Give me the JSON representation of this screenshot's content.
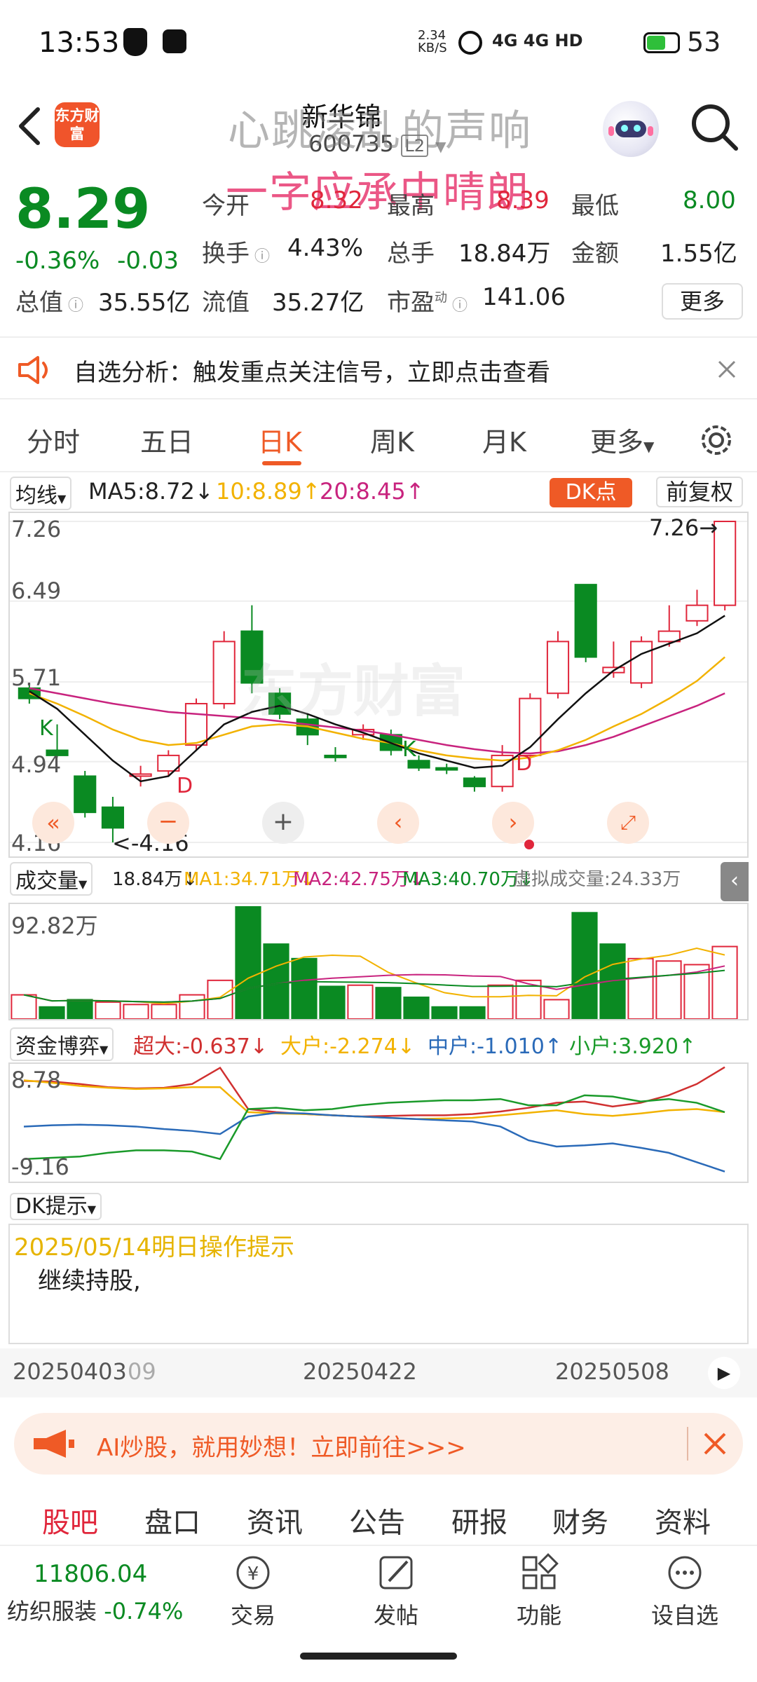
{
  "status_bar": {
    "time": "13:53",
    "net_speed": "2.34 KB/S",
    "indicators": "4G 4G HD",
    "battery": "53"
  },
  "header": {
    "logo": "东方财富",
    "stock_name": "新华锦",
    "stock_code": "600735",
    "level_badge": "L2",
    "overlay_line1": "心跳凌乱的声响",
    "overlay_line2": "一字应承中晴朗"
  },
  "quote": {
    "price": "8.29",
    "change_pct": "-0.36%",
    "change": "-0.03",
    "rows": [
      [
        {
          "label": "今开",
          "value": "8.32",
          "color": "red"
        },
        {
          "label": "最高",
          "value": "8.39",
          "color": "red"
        },
        {
          "label": "最低",
          "value": "8.00",
          "color": "green"
        }
      ],
      [
        {
          "label": "换手",
          "value": "4.43%",
          "color": "black"
        },
        {
          "label": "总手",
          "value": "18.84万",
          "color": "black"
        },
        {
          "label": "金额",
          "value": "1.55亿",
          "color": "black"
        }
      ]
    ],
    "total_value_label": "总值",
    "total_value": "35.55亿",
    "float_value_label": "流值",
    "float_value": "35.27亿",
    "pe_label": "市盈",
    "pe_sup": "动",
    "pe_value": "141.06",
    "more": "更多"
  },
  "notice": {
    "text": "自选分析：触发重点关注信号，立即点击查看"
  },
  "tabs": [
    "分时",
    "五日",
    "日K",
    "周K",
    "月K",
    "更多"
  ],
  "active_tab": "日K",
  "ma_row": {
    "selector": "均线",
    "ma5": "MA5:8.72↓",
    "ma10": "10:8.89↑",
    "ma20": "20:8.45↑",
    "dk_button": "DK点",
    "fuquan": "前复权"
  },
  "kline": {
    "y_labels": [
      "7.26",
      "6.49",
      "5.71",
      "4.94",
      "4.16"
    ],
    "max_marker": "7.26→",
    "min_marker": "<-4.16",
    "k_marks": [
      "K",
      "K"
    ],
    "d_marks": [
      "D",
      "D"
    ],
    "watermark": "东方财富"
  },
  "volume": {
    "selector": "成交量",
    "current": "18.84万↓",
    "ma1": "MA1:34.71万↓",
    "ma2": "MA2:42.75万↓",
    "ma3": "MA3:40.70万↓",
    "virtual": "虚拟成交量:24.33万",
    "max_label": "92.82万"
  },
  "fund": {
    "selector": "资金博弈",
    "super": "超大:-0.637↓",
    "large": "大户:-2.274↓",
    "mid": "中户:-1.010↑",
    "small": "小户:3.920↑",
    "max_label": "8.78",
    "min_label": "-9.16"
  },
  "dk_tip": {
    "selector": "DK提示",
    "title": "2025/05/14明日操作提示",
    "content": "继续持股,"
  },
  "dates": [
    "20250403",
    "09",
    "20250422",
    "20250508"
  ],
  "ai_banner": {
    "text": "AI炒股，就用妙想！立即前往>>>"
  },
  "sub_tabs": [
    "股吧",
    "盘口",
    "资讯",
    "公告",
    "研报",
    "财务",
    "资料"
  ],
  "bottom_nav": {
    "index_value": "11806.04",
    "index_name": "纺织服装",
    "index_change": "-0.74%",
    "items": [
      "交易",
      "发帖",
      "功能",
      "设自选"
    ]
  },
  "colors": {
    "up": "#e0263b",
    "down": "#0a8a22",
    "accent": "#ef5a26",
    "ma5": "#111111",
    "ma10": "#f2b200",
    "ma20": "#c8237e"
  },
  "chart_data": [
    {
      "type": "candlestick",
      "ylim": [
        4.16,
        7.26
      ],
      "candles": [
        {
          "o": 5.65,
          "c": 5.55,
          "h": 5.7,
          "l": 5.5
        },
        {
          "o": 5.05,
          "c": 5.0,
          "h": 5.3,
          "l": 4.98
        },
        {
          "o": 4.8,
          "c": 4.45,
          "h": 4.85,
          "l": 4.4
        },
        {
          "o": 4.5,
          "c": 4.3,
          "h": 4.6,
          "l": 4.16
        },
        {
          "o": 4.8,
          "c": 4.82,
          "h": 4.9,
          "l": 4.7
        },
        {
          "o": 4.85,
          "c": 5.0,
          "h": 5.05,
          "l": 4.8
        },
        {
          "o": 5.1,
          "c": 5.5,
          "h": 5.55,
          "l": 5.05
        },
        {
          "o": 5.5,
          "c": 6.1,
          "h": 6.2,
          "l": 5.45
        },
        {
          "o": 6.2,
          "c": 5.7,
          "h": 6.45,
          "l": 5.6
        },
        {
          "o": 5.6,
          "c": 5.4,
          "h": 5.65,
          "l": 5.35
        },
        {
          "o": 5.35,
          "c": 5.2,
          "h": 5.4,
          "l": 5.1
        },
        {
          "o": 5.0,
          "c": 4.98,
          "h": 5.08,
          "l": 4.94
        },
        {
          "o": 5.2,
          "c": 5.25,
          "h": 5.3,
          "l": 5.15
        },
        {
          "o": 5.2,
          "c": 5.05,
          "h": 5.25,
          "l": 5.0
        },
        {
          "o": 4.95,
          "c": 4.88,
          "h": 5.0,
          "l": 4.85
        },
        {
          "o": 4.88,
          "c": 4.86,
          "h": 4.92,
          "l": 4.82
        },
        {
          "o": 4.78,
          "c": 4.7,
          "h": 4.8,
          "l": 4.65
        },
        {
          "o": 4.7,
          "c": 5.0,
          "h": 5.1,
          "l": 4.65
        },
        {
          "o": 5.0,
          "c": 5.55,
          "h": 5.6,
          "l": 4.95
        },
        {
          "o": 5.6,
          "c": 6.1,
          "h": 6.2,
          "l": 5.55
        },
        {
          "o": 6.65,
          "c": 5.95,
          "h": 6.65,
          "l": 5.9
        },
        {
          "o": 5.8,
          "c": 5.85,
          "h": 6.1,
          "l": 5.75
        },
        {
          "o": 5.7,
          "c": 6.1,
          "h": 6.15,
          "l": 5.65
        },
        {
          "o": 6.1,
          "c": 6.2,
          "h": 6.45,
          "l": 6.05
        },
        {
          "o": 6.3,
          "c": 6.45,
          "h": 6.6,
          "l": 6.25
        },
        {
          "o": 6.45,
          "c": 7.26,
          "h": 7.26,
          "l": 6.4
        }
      ],
      "ma5": [
        5.62,
        5.45,
        5.2,
        4.95,
        4.75,
        4.8,
        5.05,
        5.3,
        5.42,
        5.48,
        5.4,
        5.3,
        5.22,
        5.12,
        5.02,
        4.95,
        4.88,
        4.9,
        5.08,
        5.35,
        5.6,
        5.82,
        5.98,
        6.08,
        6.18,
        6.35
      ],
      "ma10": [
        5.6,
        5.5,
        5.38,
        5.25,
        5.15,
        5.1,
        5.12,
        5.2,
        5.28,
        5.3,
        5.28,
        5.22,
        5.16,
        5.12,
        5.05,
        5.0,
        4.97,
        4.95,
        4.98,
        5.05,
        5.15,
        5.28,
        5.4,
        5.55,
        5.72,
        5.95
      ],
      "ma20": [
        5.65,
        5.6,
        5.55,
        5.5,
        5.46,
        5.42,
        5.4,
        5.38,
        5.36,
        5.33,
        5.3,
        5.27,
        5.24,
        5.2,
        5.15,
        5.1,
        5.06,
        5.03,
        5.02,
        5.04,
        5.1,
        5.18,
        5.28,
        5.38,
        5.48,
        5.6
      ]
    },
    {
      "type": "bar",
      "ylim": [
        0,
        92.82
      ],
      "values": [
        20,
        10,
        16,
        14,
        12,
        12,
        20,
        32,
        92.82,
        62,
        50,
        27,
        28,
        26,
        18,
        10,
        10,
        28,
        32,
        16,
        88,
        62,
        50,
        48,
        45,
        60
      ],
      "colors": [
        "up",
        "down",
        "down",
        "up",
        "up",
        "up",
        "up",
        "up",
        "down",
        "down",
        "down",
        "down",
        "up",
        "down",
        "down",
        "down",
        "down",
        "up",
        "up",
        "up",
        "down",
        "down",
        "up",
        "up",
        "up",
        "up"
      ]
    },
    {
      "type": "line",
      "ylim": [
        -9.16,
        8.78
      ],
      "series": [
        {
          "name": "超大",
          "color": "#d03030",
          "values": [
            6.5,
            6.4,
            6.0,
            5.5,
            5.3,
            5.4,
            6.0,
            8.6,
            2.0,
            1.5,
            1.2,
            1.0,
            0.8,
            0.9,
            1.0,
            1.0,
            1.2,
            1.6,
            2.2,
            3.0,
            3.2,
            2.4,
            3.0,
            4.2,
            6.0,
            8.7
          ]
        },
        {
          "name": "大户",
          "color": "#f2b200",
          "values": [
            6.6,
            6.2,
            5.7,
            5.4,
            5.2,
            5.3,
            5.5,
            5.5,
            1.5,
            1.3,
            1.2,
            1.0,
            0.8,
            0.6,
            0.4,
            0.5,
            0.6,
            1.0,
            1.4,
            1.8,
            1.2,
            0.9,
            1.3,
            1.8,
            2.0,
            1.5
          ]
        },
        {
          "name": "中户",
          "color": "#2a6ab8",
          "values": [
            -0.8,
            -0.6,
            -0.5,
            -0.6,
            -0.8,
            -1.2,
            -1.5,
            -2.0,
            0.8,
            1.4,
            1.3,
            1.0,
            0.8,
            0.6,
            0.4,
            0.2,
            0.0,
            -0.8,
            -3.0,
            -4.0,
            -3.8,
            -3.5,
            -4.2,
            -5.0,
            -6.5,
            -8.0
          ]
        },
        {
          "name": "小户",
          "color": "#1a9a2a",
          "values": [
            -6.0,
            -5.8,
            -5.6,
            -5.0,
            -4.6,
            -4.6,
            -4.8,
            -6.0,
            2.0,
            2.2,
            1.8,
            2.0,
            2.6,
            3.0,
            3.2,
            3.4,
            3.4,
            3.6,
            2.6,
            2.6,
            4.2,
            4.0,
            3.2,
            3.6,
            3.0,
            1.5
          ]
        }
      ]
    }
  ]
}
